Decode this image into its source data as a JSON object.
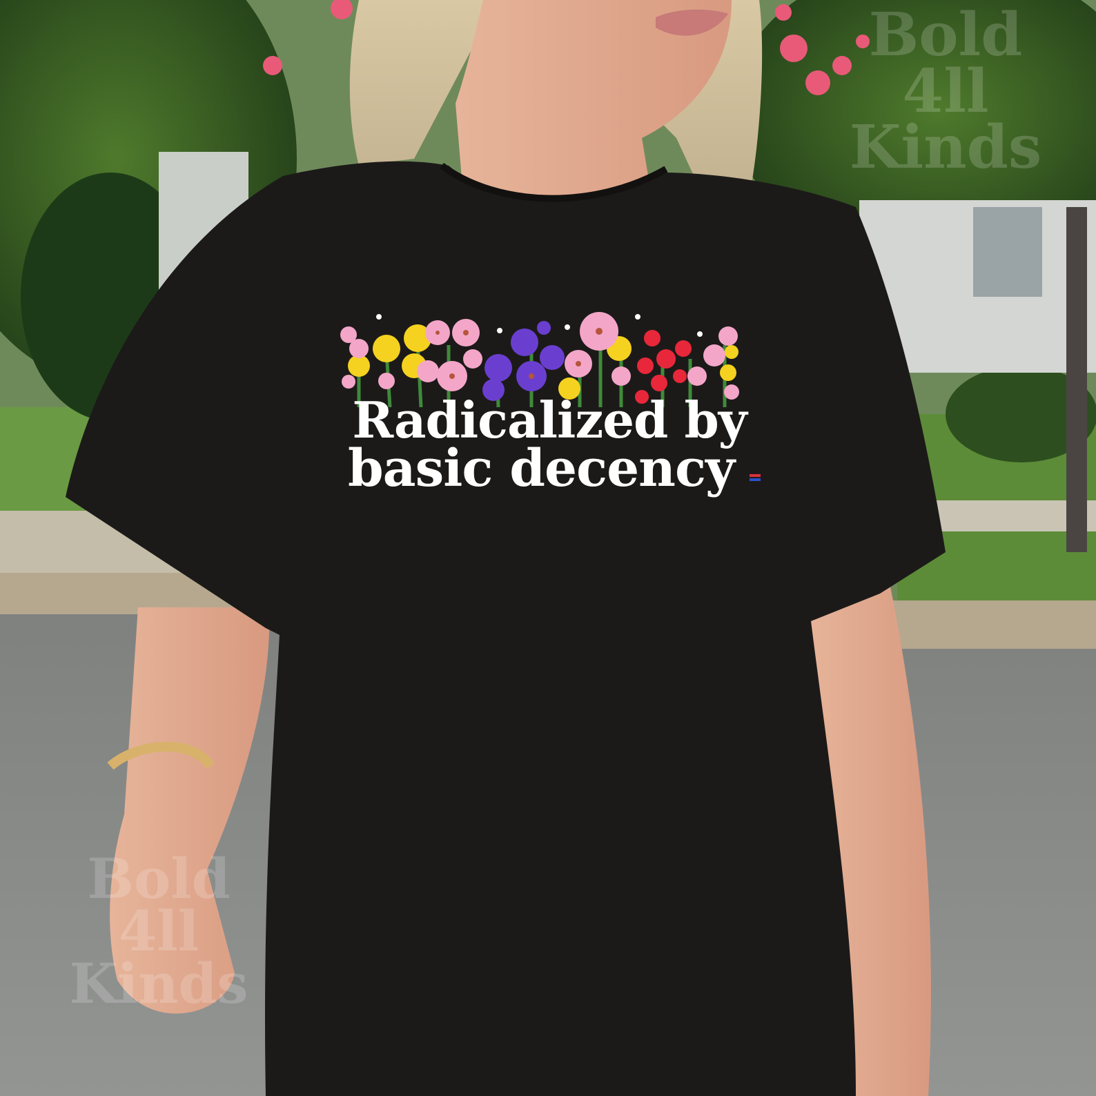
{
  "shirt_print": {
    "line1": "Radicalized by",
    "line2": "basic decency"
  },
  "watermark": {
    "lines": [
      "Bold",
      "4ll",
      "Kinds"
    ]
  },
  "colors": {
    "shirt": "#1c1a19",
    "print_text": "#ffffff",
    "flower_pink": "#f3a6c8",
    "flower_yellow": "#f5d21f",
    "flower_purple": "#6a3fcf",
    "flower_red": "#e8283a",
    "grass": "#5f8c3a",
    "road": "#8b8d8c"
  }
}
